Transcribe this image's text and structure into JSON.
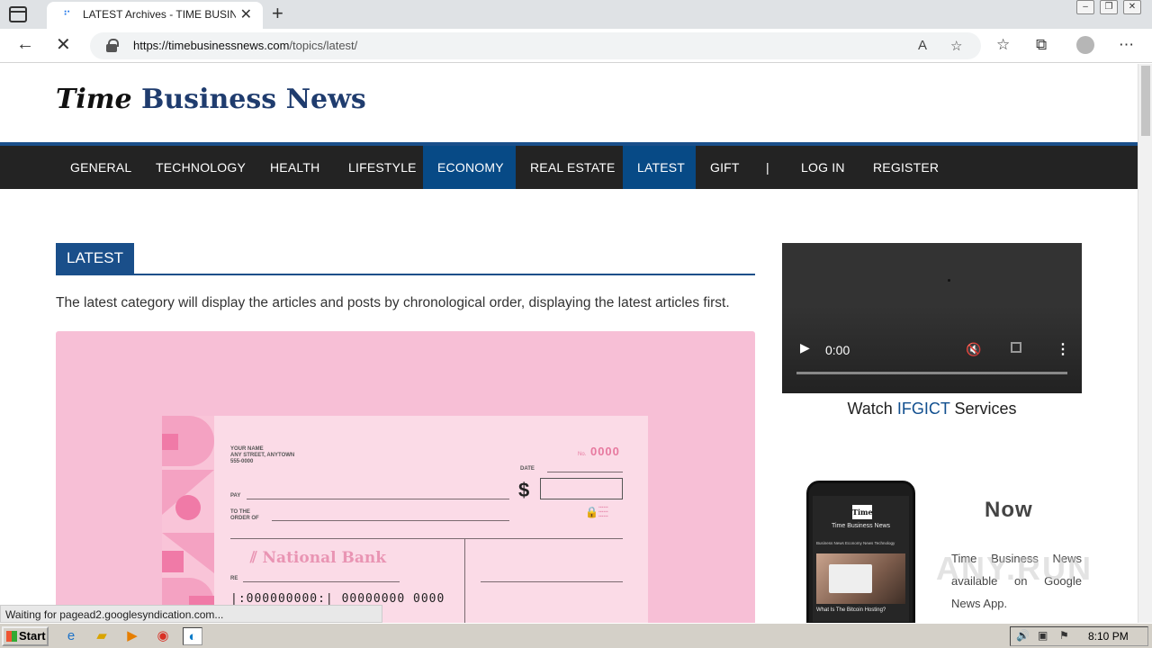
{
  "browser": {
    "tab_title": "LATEST Archives - TIME BUSINESS",
    "url_host": "https://timebusinessnews.com",
    "url_path": "/topics/latest/"
  },
  "site": {
    "logo_word1": "Time",
    "logo_word2": "Business News",
    "nav": [
      {
        "label": "GENERAL",
        "active": false
      },
      {
        "label": "TECHNOLOGY",
        "active": false
      },
      {
        "label": "HEALTH",
        "active": false
      },
      {
        "label": "LIFESTYLE",
        "active": false
      },
      {
        "label": "ECONOMY",
        "active": true
      },
      {
        "label": "REAL ESTATE",
        "active": false
      },
      {
        "label": "LATEST",
        "active": true
      },
      {
        "label": "GIFT",
        "active": false
      },
      {
        "label": "|",
        "active": false
      },
      {
        "label": "LOG IN",
        "active": false
      },
      {
        "label": "REGISTER",
        "active": false
      }
    ]
  },
  "main": {
    "section_title": "LATEST",
    "description": "The latest category will display the articles and posts by chronological order, displaying the latest articles first.",
    "cheque": {
      "name_lines": "YOUR NAME\nANY STREET, ANYTOWN\n555-0000",
      "no_label": "No.",
      "no_value": "0000",
      "date_label": "DATE",
      "pay_label": "PAY",
      "order_label": "TO THE\nORDER OF",
      "dollar": "$",
      "bank": "National Bank",
      "re_label": "RE",
      "micr": "|:000000000:|  00000000  0000"
    }
  },
  "sidebar": {
    "video_time": "0:00",
    "watch_prefix": "Watch ",
    "watch_highlight": "IFGICT",
    "watch_suffix": " Services",
    "phone_logo": "Time",
    "phone_title": "Time Business News",
    "phone_tabs": "Business News   Economy News   Technology",
    "phone_caption": "What Is The Bitcoin Hosting?",
    "now": "Now",
    "available": "Time Business News available on Google News App."
  },
  "status_text": "Waiting for pagead2.googlesyndication.com...",
  "taskbar": {
    "start": "Start",
    "clock": "8:10 PM"
  }
}
